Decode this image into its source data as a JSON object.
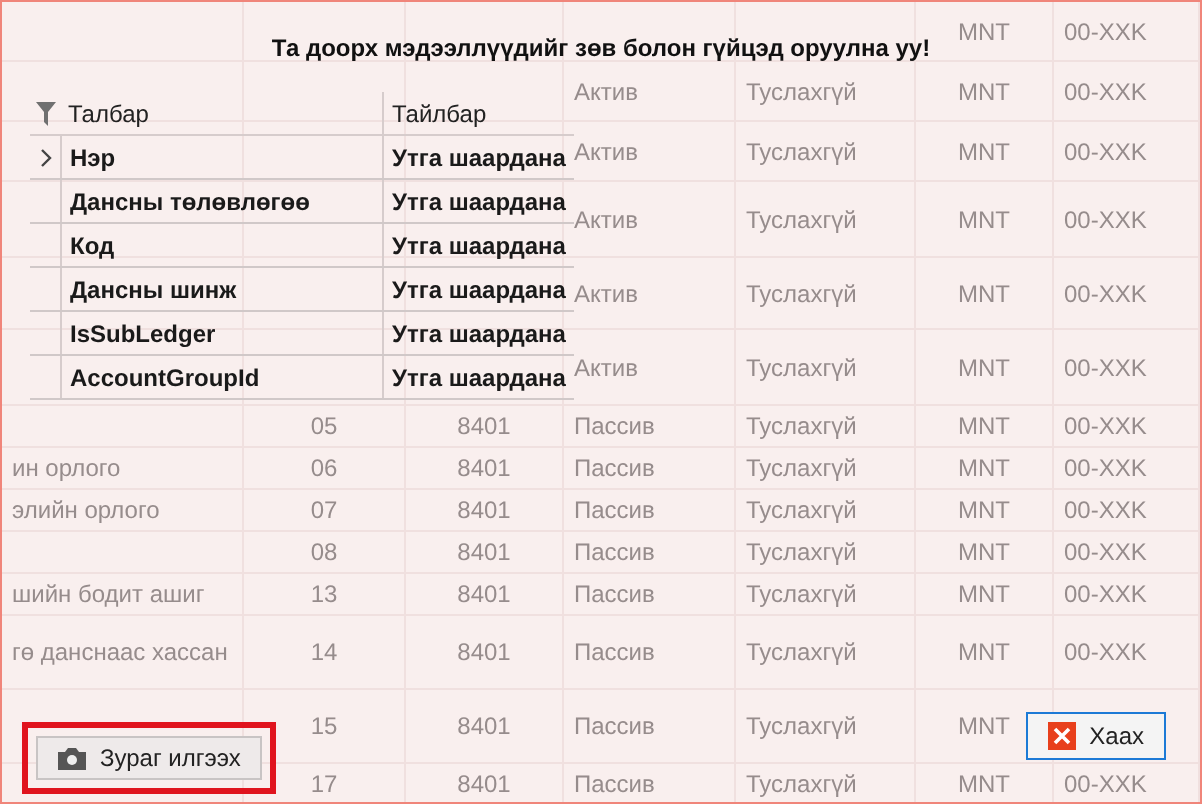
{
  "background_table": {
    "rows": [
      {
        "currency": "MNT",
        "department": "00-XXK"
      },
      {
        "type": "Актив",
        "subtype": "Туслахгүй",
        "currency": "MNT",
        "department": "00-XXK"
      },
      {
        "type": "Актив",
        "subtype": "Туслахгүй",
        "currency": "MNT",
        "department": "00-XXK"
      },
      {
        "type": "Актив",
        "subtype": "Туслахгүй",
        "currency": "MNT",
        "department": "00-XXK"
      },
      {
        "type": "Актив",
        "subtype": "Туслахгүй",
        "currency": "MNT",
        "department": "00-XXK"
      },
      {
        "type": "Актив",
        "subtype": "Туслахгүй",
        "currency": "MNT",
        "department": "00-XXK"
      },
      {
        "code": "05",
        "account": "8401",
        "type": "Пассив",
        "subtype": "Туслахгүй",
        "currency": "MNT",
        "department": "00-XXK"
      },
      {
        "name": "ин орлого",
        "code": "06",
        "account": "8401",
        "type": "Пассив",
        "subtype": "Туслахгүй",
        "currency": "MNT",
        "department": "00-XXK"
      },
      {
        "name": "элийн орлого",
        "code": "07",
        "account": "8401",
        "type": "Пассив",
        "subtype": "Туслахгүй",
        "currency": "MNT",
        "department": "00-XXK"
      },
      {
        "code": "08",
        "account": "8401",
        "type": "Пассив",
        "subtype": "Туслахгүй",
        "currency": "MNT",
        "department": "00-XXK"
      },
      {
        "name": "шийн бодит ашиг",
        "code": "13",
        "account": "8401",
        "type": "Пассив",
        "subtype": "Туслахгүй",
        "currency": "MNT",
        "department": "00-XXK"
      },
      {
        "name": "гө данснаас хассан",
        "code": "14",
        "account": "8401",
        "type": "Пассив",
        "subtype": "Туслахгүй",
        "currency": "MNT",
        "department": "00-XXK"
      },
      {
        "code": "15",
        "account": "8401",
        "type": "Пассив",
        "subtype": "Туслахгүй",
        "currency": "MNT"
      },
      {
        "code": "17",
        "account": "8401",
        "type": "Пассив",
        "subtype": "Туслахгүй",
        "currency": "MNT",
        "department": "00-XXK"
      }
    ]
  },
  "dialog": {
    "title": "Та доорх мэдээллүүдийг зөв болон гүйцэд оруулна уу!",
    "columns": [
      "Талбар",
      "Тайлбар"
    ],
    "rows": [
      {
        "field": "Нэр",
        "message": "Утга шаардана",
        "current": true
      },
      {
        "field": "Дансны төлөвлөгөө",
        "message": "Утга шаардана",
        "current": false
      },
      {
        "field": "Код",
        "message": "Утга шаардана",
        "current": false
      },
      {
        "field": "Дансны шинж",
        "message": "Утга шаардана",
        "current": false
      },
      {
        "field": "IsSubLedger",
        "message": "Утга шаардана",
        "current": false
      },
      {
        "field": "AccountGroupId",
        "message": "Утга шаардана",
        "current": false
      }
    ],
    "buttons": [
      {
        "kind": "camera",
        "label": "Зураг илгээх",
        "highlighted": true,
        "focused": false
      },
      {
        "kind": "close",
        "label": "Хаах",
        "highlighted": false,
        "focused": true
      }
    ]
  }
}
